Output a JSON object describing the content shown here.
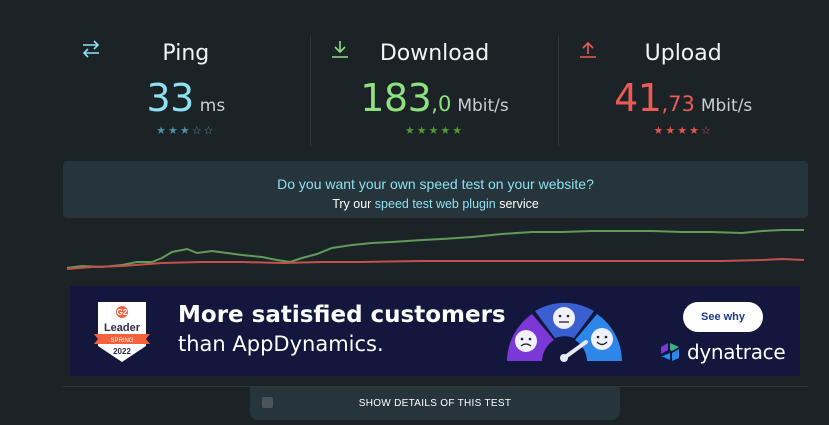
{
  "metrics": {
    "ping": {
      "label": "Ping",
      "int": "33",
      "dec": "",
      "unit": "ms",
      "stars": "★★★☆☆",
      "color": "#8de1f0",
      "star_color": "#4d8fa8"
    },
    "download": {
      "label": "Download",
      "int": "183",
      "dec": ",0",
      "unit": "Mbit/s",
      "stars": "★★★★★",
      "color": "#8fe07f",
      "star_color": "#4f9a33"
    },
    "upload": {
      "label": "Upload",
      "int": "41",
      "dec": ",73",
      "unit": "Mbit/s",
      "stars": "★★★★☆",
      "color": "#ea5b55",
      "star_color": "#e4534e"
    }
  },
  "promo": {
    "question": "Do you want your own speed test on your website?",
    "prefix": "Try our",
    "link": "speed test web plugin",
    "suffix": "service"
  },
  "ad": {
    "badge_top": "Leader",
    "badge_season": "SPRING",
    "badge_year": "2022",
    "headline": "More satisfied customers",
    "subline": "than AppDynamics.",
    "cta": "See why",
    "brand": "dynatrace"
  },
  "details": {
    "label": "SHOW DETAILS OF THIS TEST"
  },
  "colors": {
    "download_line": "#5f9c57",
    "upload_line": "#c5504c"
  }
}
